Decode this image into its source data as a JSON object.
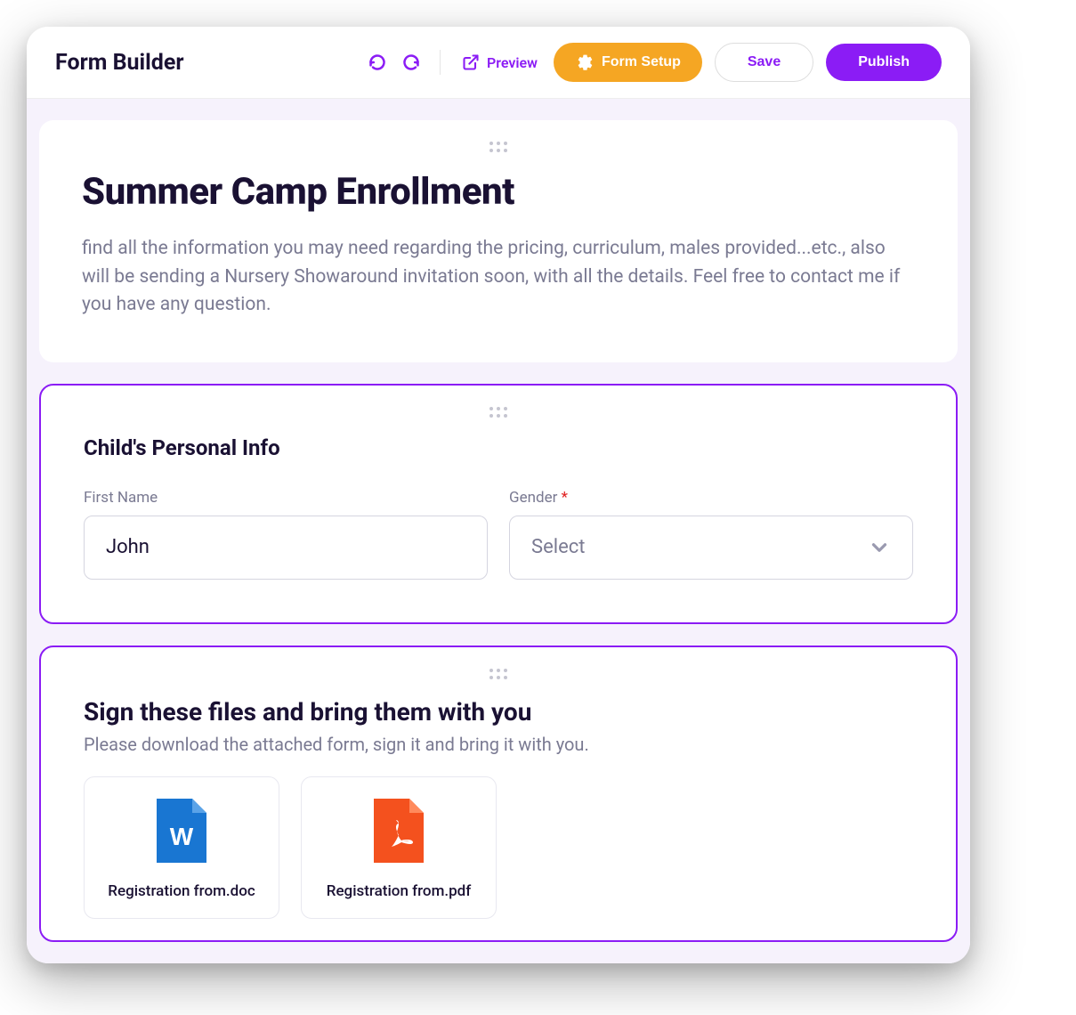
{
  "header": {
    "title": "Form Builder",
    "preview": "Preview",
    "formSetup": "Form Setup",
    "save": "Save",
    "publish": "Publish"
  },
  "titleCard": {
    "title": "Summer Camp Enrollment",
    "description": "find all the information you may need regarding the pricing, curriculum, males provided...etc., also will be sending a Nursery Showaround invitation soon, with all the details. Feel free to contact me if you have any question."
  },
  "personalInfo": {
    "sectionTitle": "Child's Personal Info",
    "firstName": {
      "label": "First Name",
      "value": "John"
    },
    "gender": {
      "label": "Gender ",
      "required": "*",
      "placeholder": "Select"
    }
  },
  "filesSection": {
    "title": "Sign these files and bring them with you",
    "description": "Please download the attached form, sign it and bring it with you.",
    "files": [
      {
        "name": "Registration from.doc",
        "type": "doc"
      },
      {
        "name": "Registration from.pdf",
        "type": "pdf"
      }
    ]
  }
}
